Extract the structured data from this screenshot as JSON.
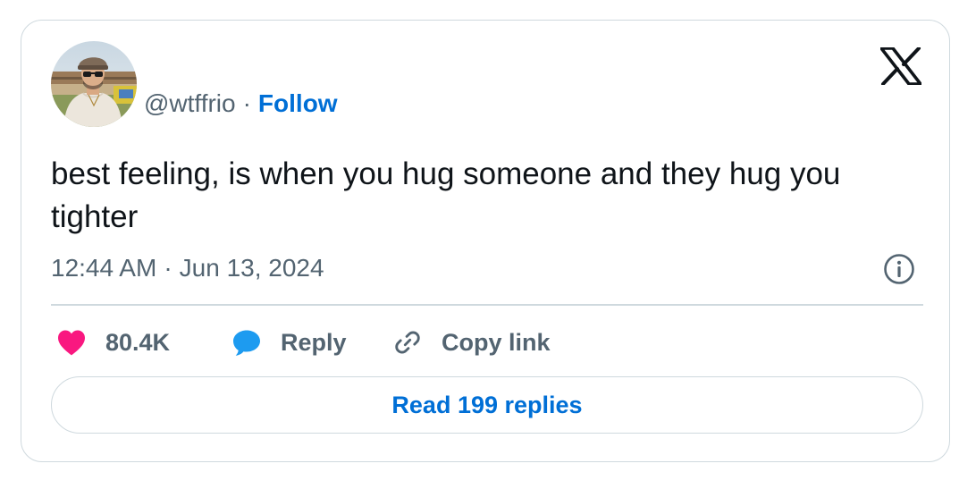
{
  "author": {
    "handle": "@wtffrio",
    "separator": "·",
    "follow_label": "Follow",
    "avatar": "profile-photo"
  },
  "brand": {
    "logo": "x-logo-icon"
  },
  "tweet": {
    "text": "best feeling, is when you hug someone and they hug you tighter",
    "time": "12:44 AM",
    "separator": "·",
    "date": "Jun 13, 2024"
  },
  "actions": {
    "like_count": "80.4K",
    "reply_label": "Reply",
    "copy_link_label": "Copy link"
  },
  "footer": {
    "read_replies_label": "Read 199 replies"
  },
  "colors": {
    "link_blue": "#006fd6",
    "like_pink": "#f91880",
    "reply_blue": "#1d9bf0",
    "secondary_text": "#536471",
    "primary_text": "#0f1419",
    "border": "#cfd9de"
  }
}
